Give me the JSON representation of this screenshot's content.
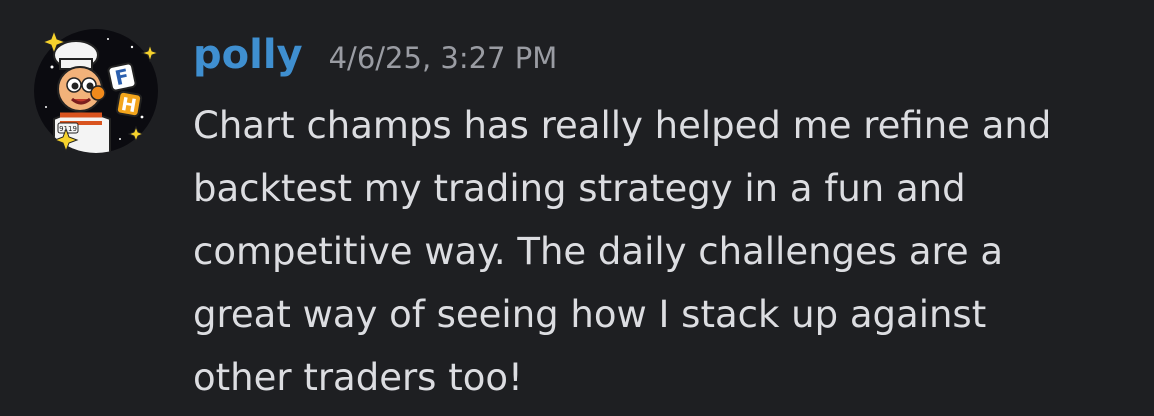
{
  "message": {
    "author": "polly",
    "timestamp": "4/6/25, 3:27 PM",
    "avatar_icon": "cartoon-chef-sparkles-avatar",
    "avatar_letters": [
      "F",
      "H"
    ],
    "avatar_badge": "9119",
    "content_lines": [
      "Chart champs has really helped me refine and",
      "backtest my trading strategy in a fun and",
      "competitive way. The daily challenges are a",
      "great way of seeing how I stack up against",
      "other traders too!"
    ]
  },
  "colors": {
    "background": "#1e1f22",
    "username": "#3f8fd0",
    "timestamp": "#9a9ca3",
    "text": "#dcdde1"
  }
}
